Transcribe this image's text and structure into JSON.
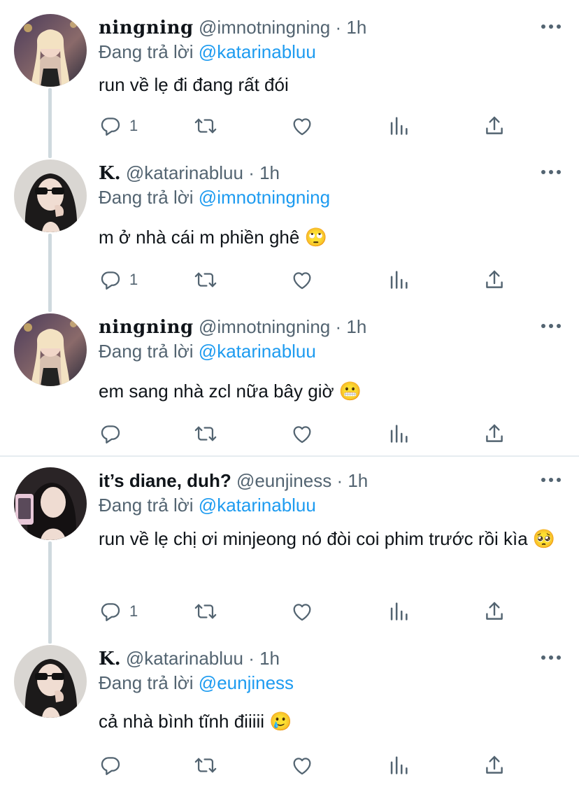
{
  "reply_prefix": "Đang trả lời",
  "tweets": [
    {
      "name": "ningning",
      "handle": "@imnotningning",
      "dot": "·",
      "time": "1h",
      "reply_to": "@katarinabluu",
      "text": "run về lẹ đi đang rất đói",
      "reply_count": "1"
    },
    {
      "name": "K.",
      "handle": "@katarinabluu",
      "dot": "·",
      "time": "1h",
      "reply_to": "@imnotningning",
      "text": "m ở nhà cái m phiền ghê 🙄",
      "reply_count": "1"
    },
    {
      "name": "ningning",
      "handle": "@imnotningning",
      "dot": "·",
      "time": "1h",
      "reply_to": "@katarinabluu",
      "text": "em sang nhà zcl nữa bây giờ 😬",
      "reply_count": ""
    },
    {
      "name": "it’s diane, duh?",
      "handle": "@eunjiness",
      "dot": "·",
      "time": "1h",
      "reply_to": "@katarinabluu",
      "text": "run về lẹ chị ơi minjeong nó đòi coi phim trước rồi kìa 🥺",
      "reply_count": "1"
    },
    {
      "name": "K.",
      "handle": "@katarinabluu",
      "dot": "·",
      "time": "1h",
      "reply_to": "@eunjiness",
      "text": "cả nhà bình tĩnh điiiii 🥲",
      "reply_count": ""
    }
  ],
  "colors": {
    "link": "#1d9bf0",
    "secondary_text": "#536471",
    "primary_text": "#0f1419",
    "thread_line": "#cfd9de",
    "divider": "#e6ecf0"
  },
  "icons": [
    "reply-icon",
    "retweet-icon",
    "like-icon",
    "analytics-icon",
    "share-icon",
    "more-icon"
  ]
}
